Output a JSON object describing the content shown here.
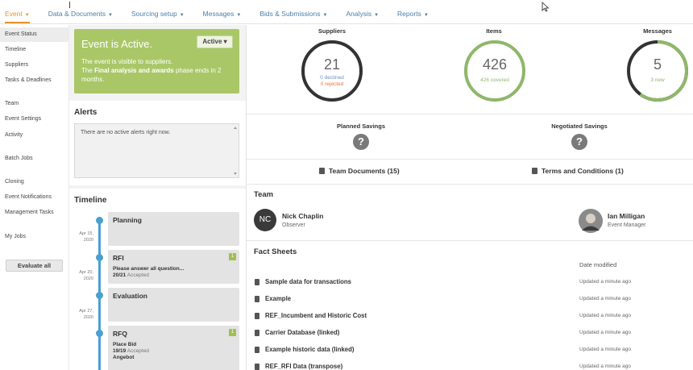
{
  "topnav": {
    "tabs": [
      {
        "label": "Event",
        "active": true
      },
      {
        "label": "Data & Documents",
        "active": false
      },
      {
        "label": "Sourcing setup",
        "active": false
      },
      {
        "label": "Messages",
        "active": false
      },
      {
        "label": "Bids & Submissions",
        "active": false
      },
      {
        "label": "Analysis",
        "active": false
      },
      {
        "label": "Reports",
        "active": false
      }
    ]
  },
  "sidebar": {
    "items": [
      {
        "label": "Event Status",
        "active": true
      },
      {
        "label": "Timeline"
      },
      {
        "label": "Suppliers"
      },
      {
        "label": "Tasks & Deadlines"
      },
      {
        "label": "Team"
      },
      {
        "label": "Event Settings"
      },
      {
        "label": "Activity"
      },
      {
        "label": "Batch Jobs"
      },
      {
        "label": "Cloning"
      },
      {
        "label": "Event Notifications"
      },
      {
        "label": "Management Tasks"
      },
      {
        "label": "My Jobs"
      }
    ],
    "evaluate_label": "Evaluate all"
  },
  "status": {
    "title": "Event is Active.",
    "line1": "The event is visible to suppliers.",
    "line2_pre": "The ",
    "line2_bold": "Final analysis and awards",
    "line2_post": " phase ends in 2 months.",
    "dropdown_label": "Active ▾",
    "color": "#a9c767"
  },
  "alerts": {
    "title": "Alerts",
    "message": "There are no active alerts right now."
  },
  "timeline": {
    "title": "Timeline",
    "phases": [
      {
        "name": "Planning",
        "date": "Apr 15, 2020"
      },
      {
        "name": "RFI",
        "date": "Apr 20, 2020",
        "badge": "1",
        "task": "Please answer all question...",
        "count": "20/21",
        "state": "Accepted"
      },
      {
        "name": "Evaluation",
        "date": "Apr 27, 2020"
      },
      {
        "name": "RFQ",
        "badge": "1",
        "task": "Place Bid",
        "count": "19/19",
        "state": "Accepted",
        "task2": "Angebot"
      }
    ]
  },
  "metrics": {
    "suppliers": {
      "label": "Suppliers",
      "value": "21",
      "sub1": "0 declined",
      "sub2": "0 rejected",
      "fraction": 1.0,
      "color": "#333333"
    },
    "items": {
      "label": "Items",
      "value": "426",
      "sub1": "426 covered",
      "fraction": 1.0,
      "color": "#8fb76a"
    },
    "messages": {
      "label": "Messages",
      "value": "5",
      "sub1": "3 new",
      "fraction": 0.6,
      "color": "#8fb76a"
    }
  },
  "savings": {
    "planned_label": "Planned Savings",
    "negotiated_label": "Negotiated Savings",
    "icon": "question-icon"
  },
  "documents": {
    "team_docs": "Team Documents (15)",
    "terms": "Terms and Conditions (1)"
  },
  "team": {
    "title": "Team",
    "members": [
      {
        "initials": "NC",
        "name": "Nick Chaplin",
        "role": "Observer"
      },
      {
        "name": "Ian Milligan",
        "role": "Event Manager"
      }
    ]
  },
  "fact_sheets": {
    "title": "Fact Sheets",
    "date_header": "Date modified",
    "rows": [
      {
        "name": "Sample data for transactions",
        "modified": "Updated a minute ago"
      },
      {
        "name": "Example",
        "modified": "Updated a minute ago"
      },
      {
        "name": "REF_Incumbent and Historic Cost",
        "modified": "Updated a minute ago"
      },
      {
        "name": "Carrier Database (linked)",
        "modified": "Updated a minute ago"
      },
      {
        "name": "Example historic data (linked)",
        "modified": "Updated a minute ago"
      },
      {
        "name": "REF_RFI Data (transpose)",
        "modified": "Updated a minute ago"
      }
    ]
  }
}
